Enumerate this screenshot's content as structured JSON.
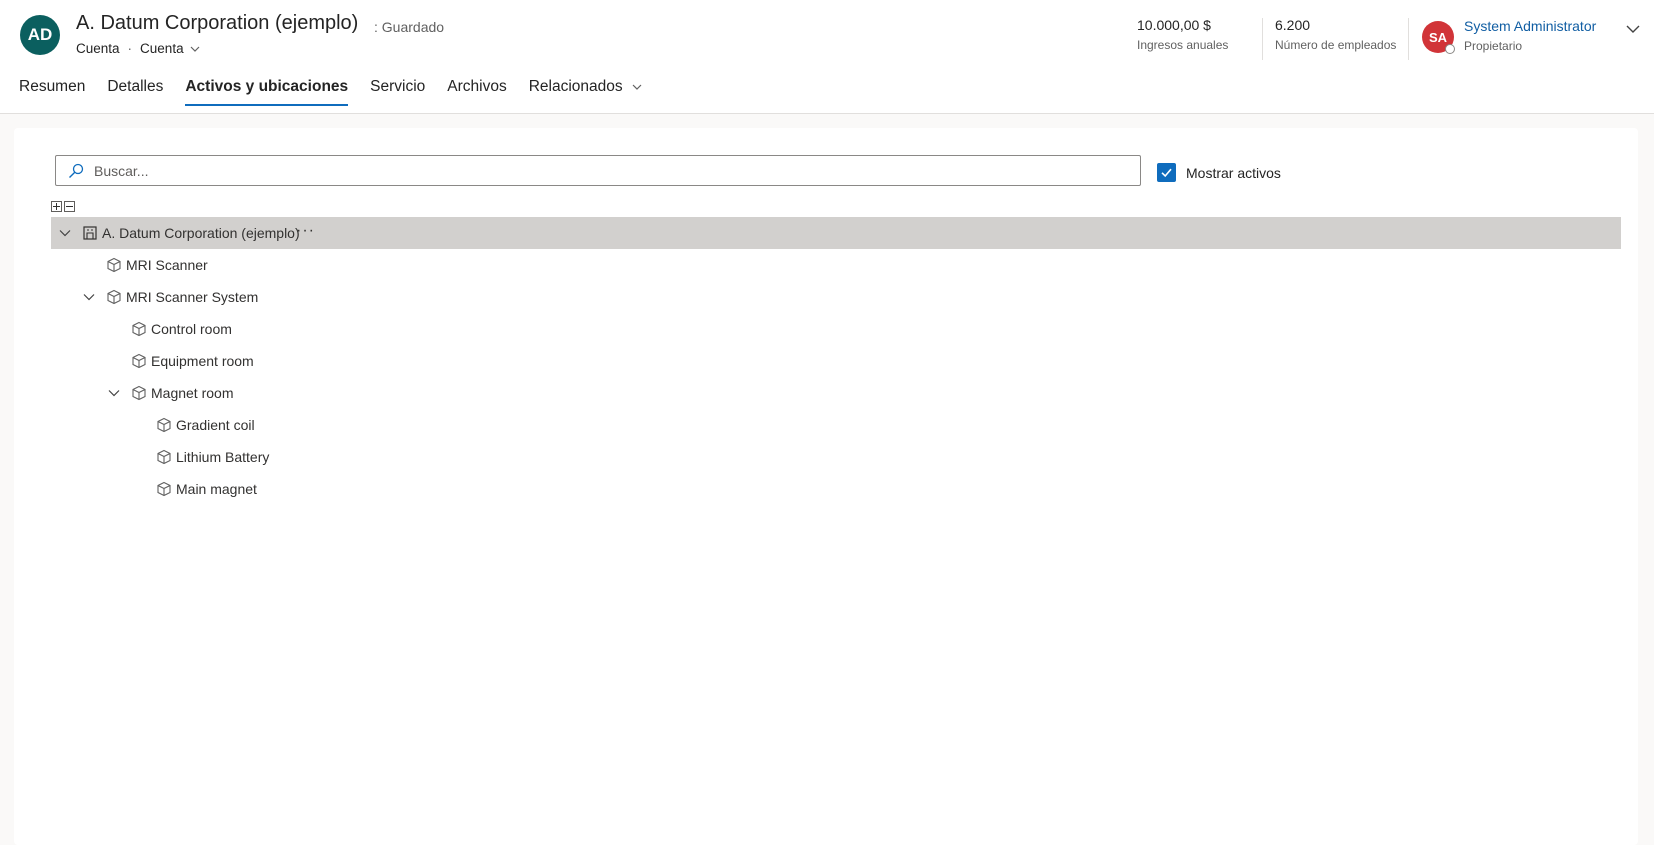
{
  "header": {
    "avatar_initials": "AD",
    "avatar_color": "#0b5f5f",
    "title": "A. Datum Corporation (ejemplo)",
    "save_status": ": Guardado",
    "entity_type": "Cuenta",
    "separator": "·",
    "form_name": "Cuenta",
    "metrics": [
      {
        "value": "10.000,00 $",
        "label": "Ingresos anuales"
      },
      {
        "value": "6.200",
        "label": "Número de empleados"
      }
    ],
    "owner": {
      "initials": "SA",
      "color": "#d13438",
      "name": "System Administrator",
      "role": "Propietario"
    }
  },
  "tabs": [
    {
      "label": "Resumen",
      "active": false
    },
    {
      "label": "Detalles",
      "active": false
    },
    {
      "label": "Activos y ubicaciones",
      "active": true
    },
    {
      "label": "Servicio",
      "active": false
    },
    {
      "label": "Archivos",
      "active": false
    },
    {
      "label": "Relacionados",
      "active": false,
      "has_dropdown": true
    }
  ],
  "search": {
    "placeholder": "Buscar..."
  },
  "show_assets": {
    "label": "Mostrar activos",
    "checked": true
  },
  "tree": {
    "root": {
      "label": "A. Datum Corporation (ejemplo)",
      "icon": "account-icon",
      "more": "···"
    },
    "nodes": [
      {
        "label": "MRI Scanner",
        "level": 1,
        "expandable": false
      },
      {
        "label": "MRI Scanner System",
        "level": 1,
        "expandable": true
      },
      {
        "label": "Control room",
        "level": 2,
        "expandable": false
      },
      {
        "label": "Equipment room",
        "level": 2,
        "expandable": false
      },
      {
        "label": "Magnet room",
        "level": 2,
        "expandable": true
      },
      {
        "label": "Gradient coil",
        "level": 3,
        "expandable": false
      },
      {
        "label": "Lithium Battery",
        "level": 3,
        "expandable": false
      },
      {
        "label": "Main magnet",
        "level": 3,
        "expandable": false
      }
    ]
  },
  "colors": {
    "accent": "#0f6cbd",
    "root_row": "#d2d0ce"
  }
}
